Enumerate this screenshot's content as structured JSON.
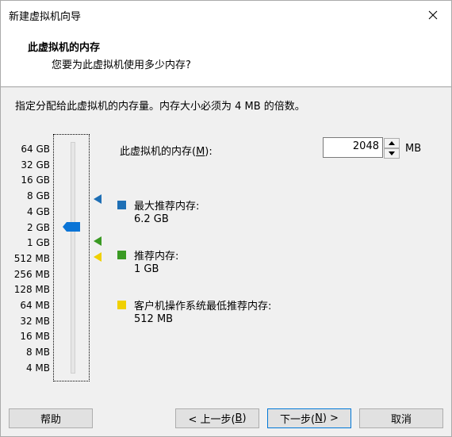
{
  "window": {
    "title": "新建虚拟机向导"
  },
  "header": {
    "title": "此虚拟机的内存",
    "subtitle": "您要为此虚拟机使用多少内存?"
  },
  "instruction": "指定分配给此虚拟机的内存量。内存大小必须为 4 MB 的倍数。",
  "slider": {
    "ticks": [
      "64 GB",
      "32 GB",
      "16 GB",
      "8 GB",
      "4 GB",
      "2 GB",
      "1 GB",
      "512 MB",
      "256 MB",
      "128 MB",
      "64 MB",
      "32 MB",
      "16 MB",
      "8 MB",
      "4 MB"
    ],
    "selected_mb": 2048
  },
  "memory": {
    "label_prefix": "此虚拟机的内存(",
    "label_accel": "M",
    "label_suffix": "):",
    "value": "2048",
    "unit": "MB"
  },
  "legend": [
    {
      "label": "最大推荐内存:",
      "value": "6.2 GB",
      "color": "#1e6fb5"
    },
    {
      "label": "推荐内存:",
      "value": "1 GB",
      "color": "#3a9a23"
    },
    {
      "label": "客户机操作系统最低推荐内存:",
      "value": "512 MB",
      "color": "#f0d000"
    }
  ],
  "buttons": {
    "help": "帮助",
    "back_prefix": "< 上一步(",
    "back_accel": "B",
    "back_suffix": ")",
    "next_prefix": "下一步(",
    "next_accel": "N",
    "next_suffix": ") >",
    "cancel": "取消"
  },
  "colors": {
    "thumb": "#0a74d6"
  }
}
